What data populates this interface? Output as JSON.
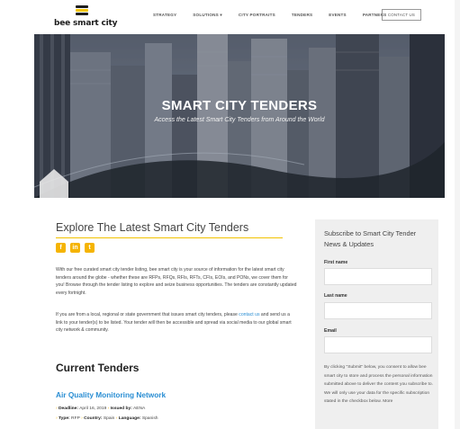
{
  "header": {
    "logo_text": "bee smart city",
    "nav": [
      "STRATEGY",
      "SOLUTIONS ▾",
      "CITY PORTRAITS",
      "TENDERS",
      "EVENTS",
      "PARTNERS"
    ],
    "contact_label": "CONTACT US"
  },
  "hero": {
    "title": "SMART CITY TENDERS",
    "subtitle": "Access the Latest Smart City Tenders from Around the World"
  },
  "main": {
    "title": "Explore The Latest Smart City Tenders",
    "social": [
      "f",
      "in",
      "t"
    ],
    "para1": "With our free curated smart city tender listing, bee smart city is your source of information for the latest smart city tenders around the globe - whether these are RFPs, RFQs, RFIs, RFTs, CFIs, EOIs, and PONs, we cover them for you! Browse through the tender listing to explore and seize business opportunities. The tenders are constantly updated every fortnight.",
    "para2_before": "If you are from a local, regional or state government that issues smart city tenders, please ",
    "para2_link": "contact us",
    "para2_after": " and send us a link to your tender(s) to be listed. Your tender will then be accessible and spread via social media to our global smart city network & community.",
    "section_title": "Current Tenders",
    "tender": {
      "title": "Air Quality Monitoring Network",
      "deadline_label": "Deadline:",
      "deadline": "April 16, 2019",
      "issued_label": "Issued by:",
      "issued": "AENA",
      "type_label": "Type:",
      "type": "RFP",
      "country_label": "Country:",
      "country": "Spain",
      "language_label": "Language:",
      "language": "Spanish"
    }
  },
  "sidebar": {
    "title": "Subscribe to Smart City Tender News & Updates",
    "first_name": "First name",
    "last_name": "Last name",
    "email": "Email",
    "note": "By clicking \"Submit\" below, you consent to allow bee smart city to store and process the personal information submitted above to deliver the content you subscribe to. We will only use your data for the specific subscription stated in the checkbox below. More"
  },
  "colors": {
    "accent": "#f5b400",
    "link": "#2a8ed3"
  }
}
